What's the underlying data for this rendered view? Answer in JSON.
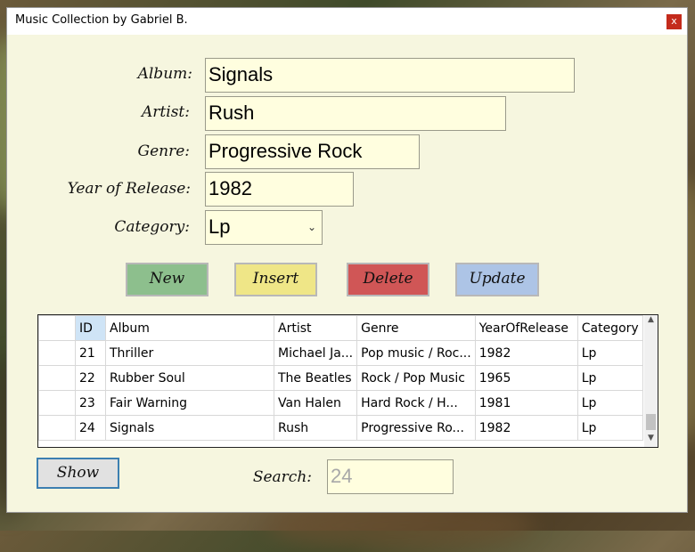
{
  "window": {
    "title": "Music Collection by Gabriel B.",
    "close_label": "x"
  },
  "form": {
    "album_label": "Album:",
    "album_value": "Signals",
    "artist_label": "Artist:",
    "artist_value": "Rush",
    "genre_label": "Genre:",
    "genre_value": "Progressive Rock",
    "year_label": "Year of Release:",
    "year_value": "1982",
    "category_label": "Category:",
    "category_value": "Lp"
  },
  "buttons": {
    "new": "New",
    "insert": "Insert",
    "delete": "Delete",
    "update": "Update",
    "show": "Show"
  },
  "colors": {
    "new": "#8dbf8d",
    "insert": "#efe687",
    "delete": "#d05656",
    "update": "#adc4e6"
  },
  "grid": {
    "columns": [
      "ID",
      "Album",
      "Artist",
      "Genre",
      "YearOfRelease",
      "Category"
    ],
    "rows": [
      [
        "21",
        "Thriller",
        "Michael Ja...",
        "Pop music / Roc...",
        "1982",
        "Lp"
      ],
      [
        "22",
        "Rubber Soul",
        "The Beatles",
        "Rock / Pop Music",
        "1965",
        "Lp"
      ],
      [
        "23",
        "Fair Warning",
        "Van Halen",
        "Hard Rock / H...",
        "1981",
        "Lp"
      ],
      [
        "24",
        "Signals",
        "Rush",
        "Progressive Ro...",
        "1982",
        "Lp"
      ]
    ]
  },
  "search": {
    "label": "Search:",
    "value": "24"
  }
}
